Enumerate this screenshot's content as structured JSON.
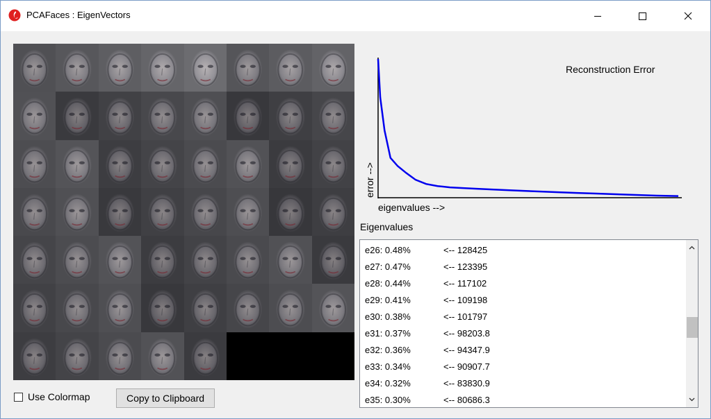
{
  "window": {
    "title": "PCAFaces : EigenVectors",
    "controls": [
      "minimize-icon",
      "maximize-icon",
      "close-icon"
    ]
  },
  "faces_panel": {
    "rows": 7,
    "cols": 8,
    "filled_cells": 53
  },
  "options": {
    "use_colormap_label": "Use Colormap",
    "use_colormap_checked": false,
    "copy_button_label": "Copy to Clipboard"
  },
  "chart_data": {
    "type": "line",
    "title": "Reconstruction Error",
    "xlabel": "eigenvalues -->",
    "ylabel": "error -->",
    "series_color": "#0000ee",
    "normalized_error_curve": [
      1.0,
      0.72,
      0.48,
      0.28,
      0.22,
      0.17,
      0.12,
      0.09,
      0.075,
      0.065,
      0.06,
      0.055,
      0.05,
      0.045,
      0.04,
      0.035,
      0.03,
      0.025,
      0.02,
      0.015,
      0.01,
      0.005,
      0.002
    ]
  },
  "eigenvalues": {
    "label": "Eigenvalues",
    "rows": [
      {
        "name": "e26: 0.48%",
        "value": "<-- 128425"
      },
      {
        "name": "e27: 0.47%",
        "value": "<-- 123395"
      },
      {
        "name": "e28: 0.44%",
        "value": "<-- 117102"
      },
      {
        "name": "e29: 0.41%",
        "value": "<-- 109198"
      },
      {
        "name": "e30: 0.38%",
        "value": "<-- 101797"
      },
      {
        "name": "e31: 0.37%",
        "value": "<-- 98203.8"
      },
      {
        "name": "e32: 0.36%",
        "value": "<-- 94347.9"
      },
      {
        "name": "e33: 0.34%",
        "value": "<-- 90907.7"
      },
      {
        "name": "e34: 0.32%",
        "value": "<-- 83830.9"
      },
      {
        "name": "e35: 0.30%",
        "value": "<-- 80686.3"
      }
    ]
  }
}
